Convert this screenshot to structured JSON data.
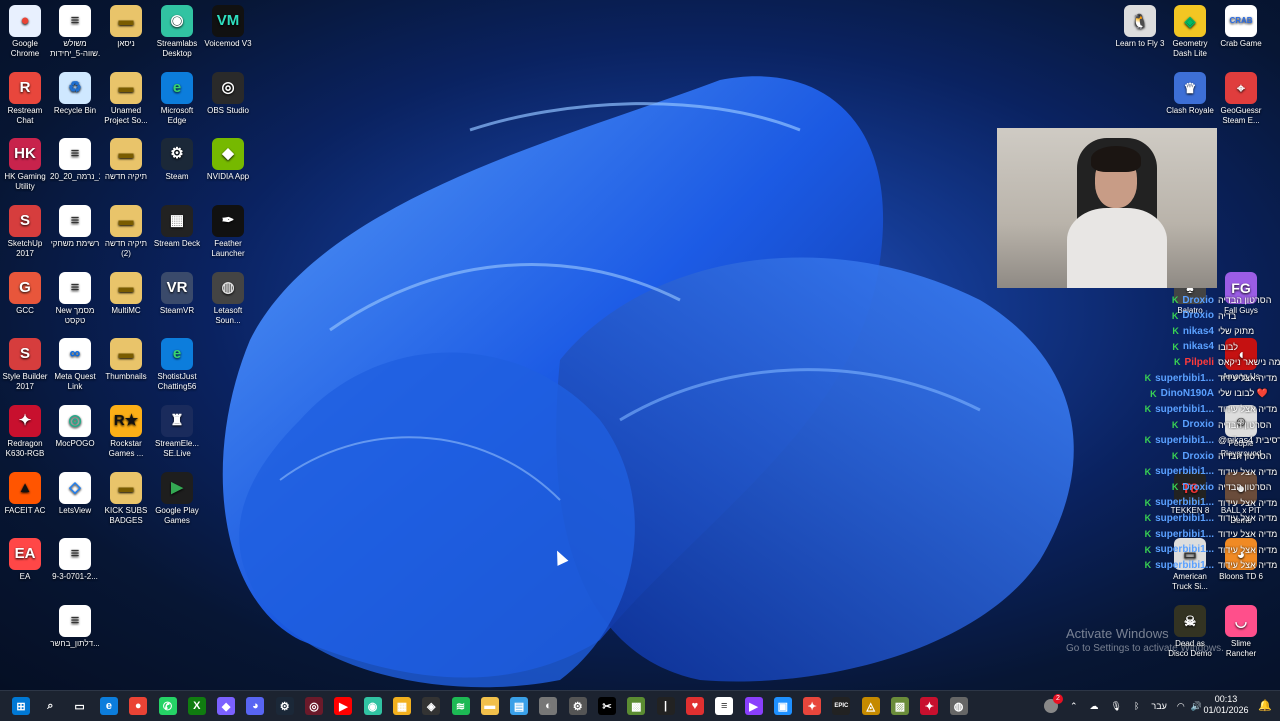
{
  "desktop_icons": [
    {
      "label": "Google Chrome",
      "color": "#e8f0fe",
      "fg": "#ea4335",
      "glyph": "●",
      "icon": "chrome-icon"
    },
    {
      "label": "משולש שווה-5_יחידות...",
      "color": "#ffffff",
      "fg": "#333",
      "glyph": "≡",
      "icon": "document-icon"
    },
    {
      "label": "ניסאן",
      "color": "#e9c46a",
      "fg": "#7a5c00",
      "glyph": "▬",
      "icon": "folder-icon"
    },
    {
      "label": "Streamlabs Desktop",
      "color": "#31c3a2",
      "fg": "#fff",
      "glyph": "◉",
      "icon": "streamlabs-icon"
    },
    {
      "label": "Voicemod V3",
      "color": "#111",
      "fg": "#2fe0c0",
      "glyph": "VM",
      "icon": "voicemod-icon"
    },
    {
      "label": "Restream Chat",
      "color": "#e8463c",
      "fg": "#fff",
      "glyph": "R",
      "icon": "restream-icon"
    },
    {
      "label": "Recycle Bin",
      "color": "#cfe8ff",
      "fg": "#1f6fd0",
      "glyph": "♻",
      "icon": "recycle-bin-icon"
    },
    {
      "label": "Unamed Project So...",
      "color": "#e9c46a",
      "fg": "#7a5c00",
      "glyph": "▬",
      "icon": "folder-icon"
    },
    {
      "label": "Microsoft Edge",
      "color": "#0c7ddc",
      "fg": "#39d36f",
      "glyph": "e",
      "icon": "edge-icon"
    },
    {
      "label": "OBS Studio",
      "color": "#2a2a2a",
      "fg": "#fff",
      "glyph": "◎",
      "icon": "obs-icon"
    },
    {
      "label": "HK Gaming Utility",
      "color": "#c8234c",
      "fg": "#fff",
      "glyph": "HK",
      "icon": "hk-gaming-icon"
    },
    {
      "label": "20_נוסחאות_20_נרמה_20...",
      "color": "#ffffff",
      "fg": "#333",
      "glyph": "≡",
      "icon": "document-icon"
    },
    {
      "label": "תיקיה חדשה",
      "color": "#e9c46a",
      "fg": "#7a5c00",
      "glyph": "▬",
      "icon": "folder-icon"
    },
    {
      "label": "Steam",
      "color": "#1b2838",
      "fg": "#fff",
      "glyph": "⚙",
      "icon": "steam-icon"
    },
    {
      "label": "NVIDIA App",
      "color": "#76b900",
      "fg": "#fff",
      "glyph": "◆",
      "icon": "nvidia-icon"
    },
    {
      "label": "SketchUp 2017",
      "color": "#d63d3d",
      "fg": "#fff",
      "glyph": "S",
      "icon": "sketchup-icon"
    },
    {
      "label": "רשימת משחקי",
      "color": "#ffffff",
      "fg": "#333",
      "glyph": "≡",
      "icon": "document-icon"
    },
    {
      "label": "תיקיה חדשה (2)",
      "color": "#e9c46a",
      "fg": "#7a5c00",
      "glyph": "▬",
      "icon": "folder-icon"
    },
    {
      "label": "Stream Deck",
      "color": "#222",
      "fg": "#fff",
      "glyph": "▦",
      "icon": "stream-deck-icon"
    },
    {
      "label": "Feather Launcher",
      "color": "#111",
      "fg": "#fff",
      "glyph": "✒",
      "icon": "feather-icon"
    },
    {
      "label": "GCC",
      "color": "#e8563b",
      "fg": "#fff",
      "glyph": "G",
      "icon": "gcc-icon"
    },
    {
      "label": "New מסמך טקסט",
      "color": "#ffffff",
      "fg": "#333",
      "glyph": "≡",
      "icon": "text-document-icon"
    },
    {
      "label": "MultiMC",
      "color": "#e9c46a",
      "fg": "#7a5c00",
      "glyph": "▬",
      "icon": "folder-icon"
    },
    {
      "label": "SteamVR",
      "color": "#3a4a6b",
      "fg": "#fff",
      "glyph": "VR",
      "icon": "steamvr-icon"
    },
    {
      "label": "Letasoft Soun...",
      "color": "#444",
      "fg": "#ddd",
      "glyph": "◍",
      "icon": "letasoft-icon"
    },
    {
      "label": "Style Builder 2017",
      "color": "#d63d3d",
      "fg": "#fff",
      "glyph": "S",
      "icon": "style-builder-icon"
    },
    {
      "label": "Meta Quest Link",
      "color": "#ffffff",
      "fg": "#0668e1",
      "glyph": "∞",
      "icon": "meta-quest-icon"
    },
    {
      "label": "Thumbnails",
      "color": "#e9c46a",
      "fg": "#7a5c00",
      "glyph": "▬",
      "icon": "folder-icon"
    },
    {
      "label": "ShotistJust Chatting56",
      "color": "#0c7ddc",
      "fg": "#39d36f",
      "glyph": "e",
      "icon": "edge-shortcut-icon"
    },
    {
      "label": "Redragon K630-RGB",
      "color": "#c8102e",
      "fg": "#fff",
      "glyph": "✦",
      "icon": "redragon-icon"
    },
    {
      "label": "MocPOGO",
      "color": "#ffffff",
      "fg": "#2a8",
      "glyph": "◎",
      "icon": "mocpogo-icon"
    },
    {
      "label": "Rockstar Games ...",
      "color": "#fcaf17",
      "fg": "#111",
      "glyph": "R★",
      "icon": "rockstar-icon"
    },
    {
      "label": "StreamEle... SE.Live",
      "color": "#1a2b5c",
      "fg": "#fff",
      "glyph": "♜",
      "icon": "streamelements-icon"
    },
    {
      "label": "FACEIT AC",
      "color": "#ff5500",
      "fg": "#111",
      "glyph": "▲",
      "icon": "faceit-icon"
    },
    {
      "label": "LetsView",
      "color": "#ffffff",
      "fg": "#1d7ef2",
      "glyph": "◇",
      "icon": "letsview-icon"
    },
    {
      "label": "KICK SUBS BADGES",
      "color": "#e9c46a",
      "fg": "#7a5c00",
      "glyph": "▬",
      "icon": "folder-icon"
    },
    {
      "label": "Google Play Games",
      "color": "#1e1e1e",
      "fg": "#34a853",
      "glyph": "▶",
      "icon": "google-play-games-icon"
    },
    {
      "label": "EA",
      "color": "#ff4747",
      "fg": "#fff",
      "glyph": "EA",
      "icon": "ea-icon"
    },
    {
      "label": "9-3-0701-2...",
      "color": "#ffffff",
      "fg": "#333",
      "glyph": "≡",
      "icon": "document-icon"
    },
    {
      "label": "דלתון_בחשר...",
      "color": "#ffffff",
      "fg": "#333",
      "glyph": "≡",
      "icon": "document-icon"
    }
  ],
  "right_icons": [
    {
      "label": "Learn to Fly 3",
      "color": "#ddd",
      "fg": "#111",
      "glyph": "🐧",
      "icon": "learn-to-fly-icon"
    },
    {
      "label": "Geometry Dash Lite",
      "color": "#f3c623",
      "fg": "#0b6",
      "glyph": "◈",
      "icon": "geometry-dash-icon"
    },
    {
      "label": "Crab Game",
      "color": "#ffffff",
      "fg": "#2b6be0",
      "glyph": "CRAB",
      "icon": "crab-game-icon"
    },
    {
      "label": "Clash Royale",
      "color": "#3d6fd6",
      "fg": "#fff",
      "glyph": "♛",
      "icon": "clash-royale-icon"
    },
    {
      "label": "GeoGuessr Steam E...",
      "color": "#e03d3d",
      "fg": "#fff",
      "glyph": "⌖",
      "icon": "geoguessr-icon"
    },
    {
      "label": "Balatro",
      "color": "#444",
      "fg": "#fff",
      "glyph": "♠",
      "icon": "balatro-icon"
    },
    {
      "label": "Fall Guys",
      "color": "#9b5de5",
      "fg": "#fff",
      "glyph": "FG",
      "icon": "fall-guys-icon"
    },
    {
      "label": "Among Us",
      "color": "#c51111",
      "fg": "#fff",
      "glyph": "◖",
      "icon": "among-us-icon"
    },
    {
      "label": "People Playground",
      "color": "#ddd",
      "fg": "#333",
      "glyph": "☺",
      "icon": "people-playground-icon"
    },
    {
      "label": "BALL x PIT Demo",
      "color": "#6a4c3b",
      "fg": "#fff",
      "glyph": "●",
      "icon": "ball-x-pit-icon"
    },
    {
      "label": "Bloons TD 6",
      "color": "#f08a24",
      "fg": "#fff",
      "glyph": "◕",
      "icon": "bloons-icon"
    },
    {
      "label": "Slime Rancher",
      "color": "#ff4f8b",
      "fg": "#fff",
      "glyph": "◡",
      "icon": "slime-rancher-icon"
    },
    {
      "label": "Dead as Disco Demo",
      "color": "#332",
      "fg": "#fff",
      "glyph": "☠",
      "icon": "dead-as-disco-icon"
    },
    {
      "label": "TEKKEN 8",
      "color": "#222",
      "fg": "#e33",
      "glyph": "T8",
      "icon": "tekken-icon"
    },
    {
      "label": "American Truck Si...",
      "color": "#ddd",
      "fg": "#333",
      "glyph": "▭",
      "icon": "american-truck-icon"
    }
  ],
  "chat": [
    {
      "user": "Droxio",
      "color": "#5aa0ff",
      "msg": "הסרטון הבדיה"
    },
    {
      "user": "Droxio",
      "color": "#5aa0ff",
      "msg": "בדיה"
    },
    {
      "user": "nikas4",
      "color": "#5aa0ff",
      "msg": "מתוק שלי"
    },
    {
      "user": "nikas4",
      "color": "#5aa0ff",
      "msg": "לבובו"
    },
    {
      "user": "Pilpeli",
      "color": "#ff3b3b",
      "msg": "מה נישאר ניקאס"
    },
    {
      "user": "superbibi1...",
      "color": "#5aa0ff",
      "msg": "תראה מדיה אצל עידוד"
    },
    {
      "user": "DinoN190A",
      "color": "#5aa0ff",
      "msg": "לבובו שלי ❤️"
    },
    {
      "user": "superbibi1...",
      "color": "#5aa0ff",
      "msg": "תראה מדיה אצל עידוד"
    },
    {
      "user": "Droxio",
      "color": "#5aa0ff",
      "msg": "הסרטון הבדיה"
    },
    {
      "user": "superbibi1...",
      "color": "#5aa0ff",
      "msg": "@nikas4 אגרסיבית"
    },
    {
      "user": "Droxio",
      "color": "#5aa0ff",
      "msg": "הסרטון הבדיה"
    },
    {
      "user": "superbibi1...",
      "color": "#5aa0ff",
      "msg": "תראה מדיה אצל עידוד"
    },
    {
      "user": "Droxio",
      "color": "#5aa0ff",
      "msg": "הסרטון הבדיה"
    },
    {
      "user": "superbibi1...",
      "color": "#5aa0ff",
      "msg": "תראה מדיה אצל עידוד"
    },
    {
      "user": "superbibi1...",
      "color": "#5aa0ff",
      "msg": "תראה מדיה אצל עידוד"
    },
    {
      "user": "superbibi1...",
      "color": "#5aa0ff",
      "msg": "תראה מדיה אצל עידוד"
    },
    {
      "user": "superbibi1...",
      "color": "#5aa0ff",
      "msg": "תראה מדיה אצל עידוד"
    },
    {
      "user": "superbibi1...",
      "color": "#5aa0ff",
      "msg": "תראה מדיה אצל עידוד"
    }
  ],
  "chat_badge": "K",
  "watermark": {
    "line1": "Activate Windows",
    "line2": "Go to Settings to activate Windows."
  },
  "taskbar_apps": [
    {
      "name": "start-icon",
      "color": "#0078d4",
      "glyph": "⊞"
    },
    {
      "name": "search-icon",
      "color": "transparent",
      "glyph": "⌕"
    },
    {
      "name": "task-view-icon",
      "color": "transparent",
      "glyph": "▭"
    },
    {
      "name": "edge-icon",
      "color": "#0c7ddc",
      "glyph": "e"
    },
    {
      "name": "chrome-icon",
      "color": "#ea4335",
      "glyph": "●"
    },
    {
      "name": "whatsapp-icon",
      "color": "#25d366",
      "glyph": "✆"
    },
    {
      "name": "xbox-icon",
      "color": "#107c10",
      "glyph": "X"
    },
    {
      "name": "copilot-icon",
      "color": "#7b61ff",
      "glyph": "◆"
    },
    {
      "name": "discord-icon",
      "color": "#5865f2",
      "glyph": "◕"
    },
    {
      "name": "steam-icon",
      "color": "#1b2838",
      "glyph": "⚙"
    },
    {
      "name": "obs-icon",
      "color": "#6b1a2a",
      "glyph": "◎"
    },
    {
      "name": "youtube-icon",
      "color": "#ff0000",
      "glyph": "▶"
    },
    {
      "name": "streamlabs-icon",
      "color": "#31c3a2",
      "glyph": "◉"
    },
    {
      "name": "store-icon",
      "color": "#f2b01e",
      "glyph": "▦"
    },
    {
      "name": "vpn-icon",
      "color": "#333",
      "glyph": "◈"
    },
    {
      "name": "spotify-icon",
      "color": "#1db954",
      "glyph": "≋"
    },
    {
      "name": "file-explorer-icon",
      "color": "#f2c04b",
      "glyph": "▬"
    },
    {
      "name": "notepad-icon",
      "color": "#3aa0e8",
      "glyph": "▤"
    },
    {
      "name": "security-icon",
      "color": "#777",
      "glyph": "◐"
    },
    {
      "name": "settings-icon",
      "color": "#555",
      "glyph": "⚙"
    },
    {
      "name": "capcut-icon",
      "color": "#000",
      "glyph": "✂"
    },
    {
      "name": "minecraft-icon",
      "color": "#5b8c32",
      "glyph": "▩"
    },
    {
      "name": "notes-icon",
      "color": "#222",
      "glyph": "|"
    },
    {
      "name": "heart-app-icon",
      "color": "#e03030",
      "glyph": "♥"
    },
    {
      "name": "document-icon",
      "color": "#ffffff",
      "glyph": "≡"
    },
    {
      "name": "video-editor-icon",
      "color": "#8a3ffc",
      "glyph": "▶"
    },
    {
      "name": "remote-icon",
      "color": "#1e90ff",
      "glyph": "▣"
    },
    {
      "name": "game-app-icon",
      "color": "#e8463c",
      "glyph": "✦"
    },
    {
      "name": "epic-games-icon",
      "color": "#222",
      "glyph": "EPIC"
    },
    {
      "name": "gamebar-icon",
      "color": "#c58a00",
      "glyph": "◬"
    },
    {
      "name": "minecraft-launcher-icon",
      "color": "#6a8c3a",
      "glyph": "▨"
    },
    {
      "name": "redragon-app-icon",
      "color": "#c8102e",
      "glyph": "✦"
    },
    {
      "name": "recording-icon",
      "color": "#666",
      "glyph": "◍"
    }
  ],
  "tray": {
    "language": "עבר",
    "time": "00:13",
    "date": "01/01/2026",
    "notification_count": "2"
  }
}
